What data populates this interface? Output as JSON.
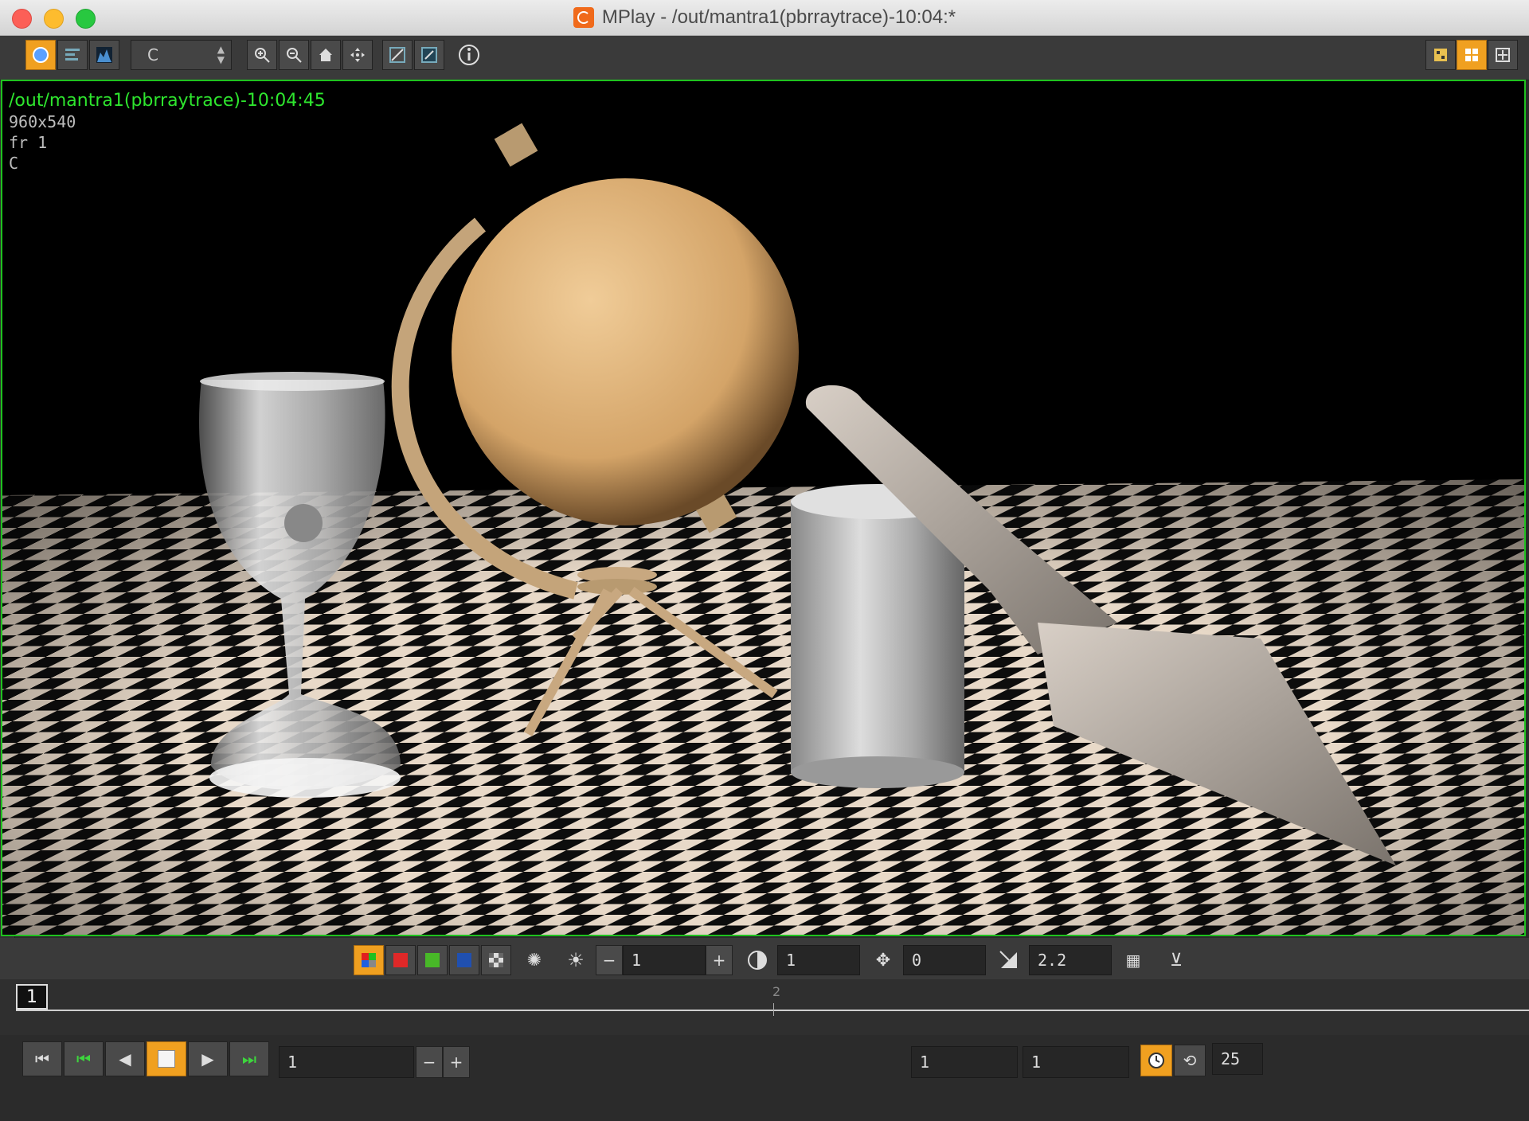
{
  "window": {
    "title": "MPlay - /out/mantra1(pbrraytrace)-10:04:*"
  },
  "toolbar": {
    "channel_select": "C",
    "buttons": [
      "view-image-icon",
      "view-composite-icon",
      "histogram-icon",
      "zoom-in-icon",
      "zoom-out-icon",
      "home-icon",
      "frame-fit-icon",
      "snapshot-icon",
      "compare-icon",
      "info-icon",
      "layout-single-icon",
      "layout-quad-icon",
      "layout-full-icon"
    ]
  },
  "viewport": {
    "path": "/out/mantra1(pbrraytrace)-10:04:45",
    "resolution": "960x540",
    "frame_label": "fr 1",
    "plane": "C"
  },
  "color_bar": {
    "brightness_value": "1",
    "exposure_value": "1",
    "black_point_value": "0",
    "gamma_value": "2.2"
  },
  "timeline": {
    "current_frame": "1",
    "tick_label": "2"
  },
  "playback": {
    "frame_field": "1",
    "start_field": "1",
    "end_field": "1",
    "fps_field": "25"
  }
}
